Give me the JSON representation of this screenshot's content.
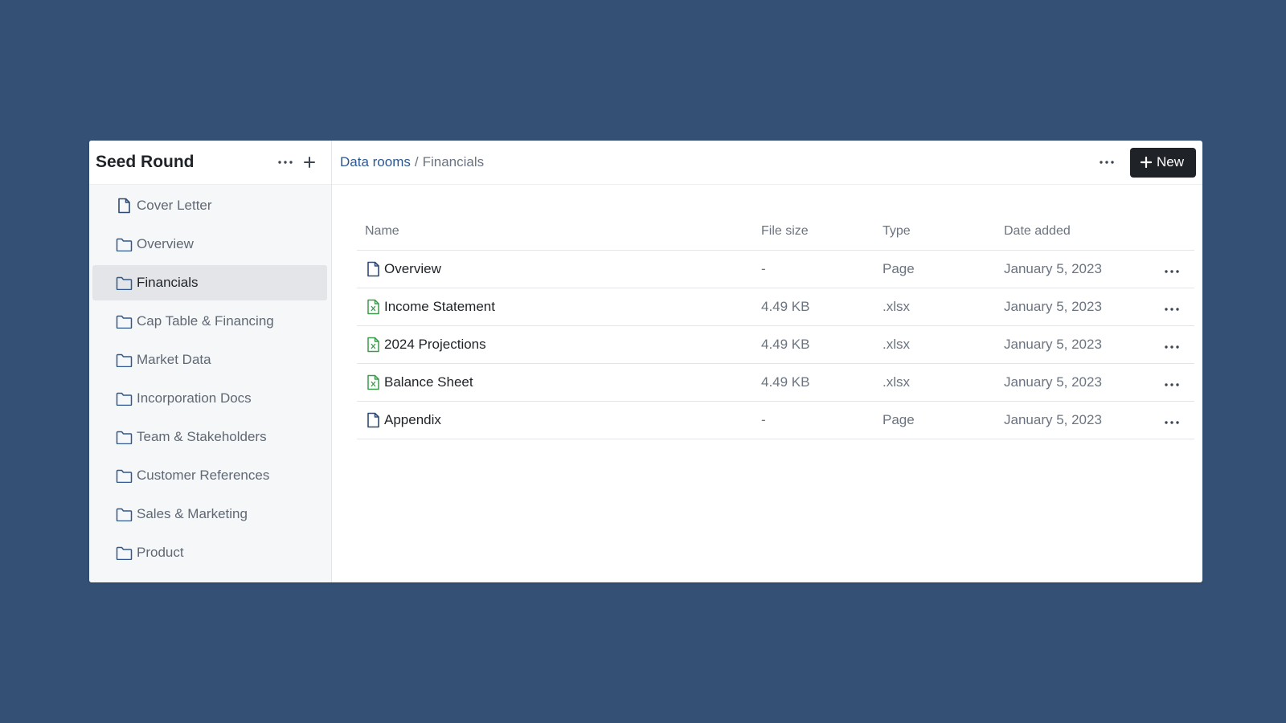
{
  "sidebar": {
    "title": "Seed Round",
    "more_icon": "ellipsis-icon",
    "add_icon": "plus-icon",
    "items": [
      {
        "label": "Cover Letter",
        "icon": "document-icon",
        "active": false
      },
      {
        "label": "Overview",
        "icon": "folder-icon",
        "active": false
      },
      {
        "label": "Financials",
        "icon": "folder-icon",
        "active": true
      },
      {
        "label": "Cap Table & Financing",
        "icon": "folder-icon",
        "active": false
      },
      {
        "label": "Market Data",
        "icon": "folder-icon",
        "active": false
      },
      {
        "label": "Incorporation Docs",
        "icon": "folder-icon",
        "active": false
      },
      {
        "label": "Team & Stakeholders",
        "icon": "folder-icon",
        "active": false
      },
      {
        "label": "Customer References",
        "icon": "folder-icon",
        "active": false
      },
      {
        "label": "Sales & Marketing",
        "icon": "folder-icon",
        "active": false
      },
      {
        "label": "Product",
        "icon": "folder-icon",
        "active": false
      }
    ]
  },
  "header": {
    "breadcrumb_root": "Data rooms",
    "breadcrumb_separator": "/",
    "breadcrumb_current": "Financials",
    "new_button_label": "New"
  },
  "table": {
    "columns": {
      "name": "Name",
      "size": "File size",
      "type": "Type",
      "date": "Date added"
    },
    "rows": [
      {
        "name": "Overview",
        "size": "-",
        "type": "Page",
        "date": "January 5, 2023",
        "icon": "document-icon"
      },
      {
        "name": "Income Statement",
        "size": "4.49 KB",
        "type": ".xlsx",
        "date": "January 5, 2023",
        "icon": "spreadsheet-icon"
      },
      {
        "name": "2024 Projections",
        "size": "4.49 KB",
        "type": ".xlsx",
        "date": "January 5, 2023",
        "icon": "spreadsheet-icon"
      },
      {
        "name": "Balance Sheet",
        "size": "4.49 KB",
        "type": ".xlsx",
        "date": "January 5, 2023",
        "icon": "spreadsheet-icon"
      },
      {
        "name": "Appendix",
        "size": "-",
        "type": "Page",
        "date": "January 5, 2023",
        "icon": "document-icon"
      }
    ]
  },
  "colors": {
    "background": "#345175",
    "link": "#2d5891",
    "folder_icon": "#2d5891",
    "spreadsheet_icon": "#3a9a4a",
    "primary_button": "#1f2328",
    "active_item": "#e3e5e8"
  }
}
